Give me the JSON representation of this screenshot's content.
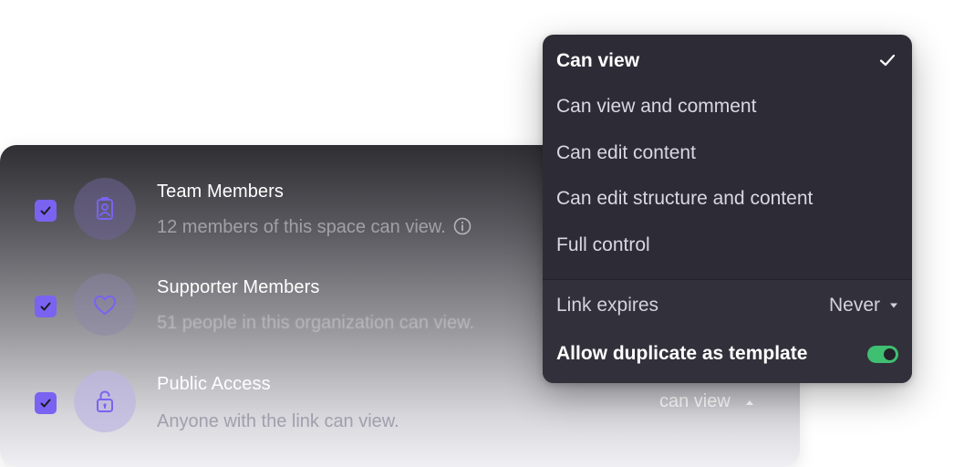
{
  "sharing": {
    "rows": [
      {
        "title": "Team Members",
        "subtitle": "12 members of this space can view.",
        "checked": true,
        "icon": "id-badge-icon"
      },
      {
        "title": "Supporter Members",
        "subtitle": "51 people in this organization can view.",
        "checked": true,
        "icon": "heart-icon"
      },
      {
        "title": "Public Access",
        "subtitle": "Anyone with the link can view.",
        "checked": true,
        "icon": "lock-open-icon",
        "permission": "can view"
      }
    ]
  },
  "menu": {
    "options": [
      "Can view",
      "Can view and comment",
      "Can edit content",
      "Can edit structure and content",
      "Full control"
    ],
    "selected": "Can view",
    "link_expires_label": "Link expires",
    "link_expires_value": "Never",
    "allow_duplicate_label": "Allow duplicate as template",
    "allow_duplicate_on": true
  },
  "colors": {
    "accent": "#7a63f0",
    "menu_bg": "#2d2c36",
    "toggle_on": "#3fbf72"
  }
}
